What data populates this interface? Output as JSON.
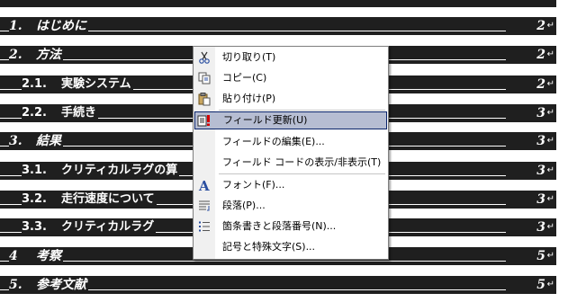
{
  "toc": [
    {
      "num": "1.",
      "title": "はじめに",
      "page": "2",
      "level": 1
    },
    {
      "num": "2.",
      "title": "方法",
      "page": "2",
      "level": 1
    },
    {
      "num": "2.1.",
      "title": "実験システム",
      "page": "2",
      "level": 2
    },
    {
      "num": "2.2.",
      "title": "手続き",
      "page": "3",
      "level": 2
    },
    {
      "num": "3.",
      "title": "結果",
      "page": "3",
      "level": 1
    },
    {
      "num": "3.1.",
      "title": "クリティカルラグの算",
      "page": "3",
      "level": 2
    },
    {
      "num": "3.2.",
      "title": "走行速度について",
      "page": "3",
      "level": 2
    },
    {
      "num": "3.3.",
      "title": "クリティカルラグ",
      "page": "3",
      "level": 2
    },
    {
      "num": "4",
      "title": "考察",
      "page": "5",
      "level": 1
    },
    {
      "num": "5.",
      "title": "参考文献",
      "page": "5",
      "level": 1
    }
  ],
  "paragraph_mark": "↵",
  "menu": {
    "items": [
      {
        "label": "切り取り(T)",
        "icon": "scissors-icon"
      },
      {
        "label": "コピー(C)",
        "icon": "copy-icon"
      },
      {
        "label": "貼り付け(P)",
        "icon": "paste-icon"
      },
      {
        "label": "フィールド更新(U)",
        "icon": "update-field-icon",
        "highlighted": true
      },
      {
        "label": "フィールドの編集(E)...",
        "icon": ""
      },
      {
        "label": "フィールド コードの表示/非表示(T)",
        "icon": ""
      },
      {
        "label": "フォント(F)...",
        "icon": "font-icon"
      },
      {
        "label": "段落(P)...",
        "icon": "paragraph-icon"
      },
      {
        "label": "箇条書きと段落番号(N)...",
        "icon": "bullets-icon"
      },
      {
        "label": "記号と特殊文字(S)...",
        "icon": ""
      }
    ]
  },
  "colors": {
    "field_shading": "#1f1f1f",
    "menu_highlight": "#b6bdd2",
    "menu_highlight_border": "#0a246a"
  }
}
